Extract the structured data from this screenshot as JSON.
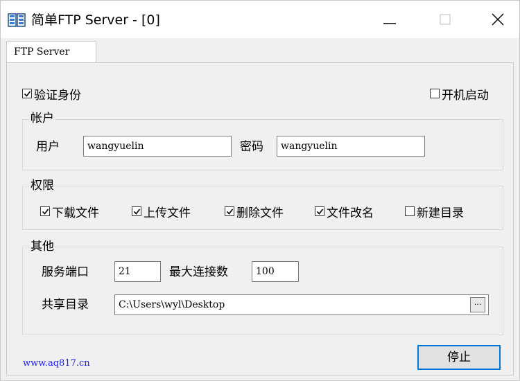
{
  "window": {
    "title": "简单FTP Server - [0]"
  },
  "tabs": [
    {
      "label": "FTP Server"
    }
  ],
  "options": {
    "verify_identity": {
      "label": "验证身份",
      "checked": true
    },
    "autostart": {
      "label": "开机启动",
      "checked": false
    }
  },
  "account": {
    "legend": "帐户",
    "user_label": "用户",
    "user_value": "wangyuelin",
    "password_label": "密码",
    "password_value": "wangyuelin"
  },
  "permissions": {
    "legend": "权限",
    "items": [
      {
        "label": "下载文件",
        "checked": true
      },
      {
        "label": "上传文件",
        "checked": true
      },
      {
        "label": "删除文件",
        "checked": true
      },
      {
        "label": "文件改名",
        "checked": true
      },
      {
        "label": "新建目录",
        "checked": false
      }
    ]
  },
  "other": {
    "legend": "其他",
    "port_label": "服务端口",
    "port_value": "21",
    "max_conn_label": "最大连接数",
    "max_conn_value": "100",
    "share_dir_label": "共享目录",
    "share_dir_value": "C:\\Users\\wyl\\Desktop",
    "browse_label": "..."
  },
  "footer": {
    "link": "www.aq817.cn",
    "stop_button": "停止"
  },
  "colors": {
    "accent": "#0078d7",
    "link": "#1a1aff",
    "window_bg": "#f0f0f0"
  }
}
